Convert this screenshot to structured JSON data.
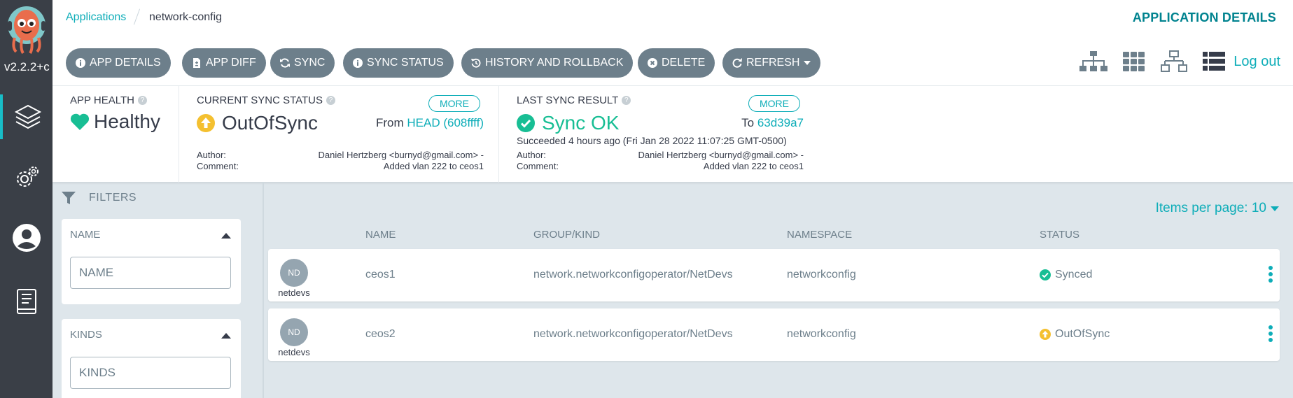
{
  "sidebar": {
    "version": "v2.2.2+c",
    "items": [
      {
        "name": "applications"
      },
      {
        "name": "settings"
      },
      {
        "name": "user-info"
      },
      {
        "name": "documentation"
      }
    ]
  },
  "breadcrumb": {
    "root": "Applications",
    "current": "network-config"
  },
  "page_title": "APPLICATION DETAILS",
  "toolbar": {
    "buttons": [
      {
        "label": "APP DETAILS",
        "icon": "info-circle-icon"
      },
      {
        "label": "APP DIFF",
        "icon": "file-diff-icon"
      },
      {
        "label": "SYNC",
        "icon": "sync-icon"
      },
      {
        "label": "SYNC STATUS",
        "icon": "info-circle-icon"
      },
      {
        "label": "HISTORY AND ROLLBACK",
        "icon": "history-icon"
      },
      {
        "label": "DELETE",
        "icon": "times-circle-icon"
      },
      {
        "label": "REFRESH",
        "icon": "redo-icon"
      }
    ],
    "logout": "Log out"
  },
  "app_health": {
    "label": "APP HEALTH",
    "value": "Healthy",
    "color": "#18be94"
  },
  "current_sync": {
    "label": "CURRENT SYNC STATUS",
    "more": "MORE",
    "value": "OutOfSync",
    "color": "#f4c030",
    "from_label": "From",
    "from_value": "HEAD (608ffff)",
    "author_label": "Author:",
    "comment_label": "Comment:",
    "author_value": "Daniel Hertzberg <burnyd@gmail.com> -",
    "comment_value": "Added vlan 222 to ceos1"
  },
  "last_sync": {
    "label": "LAST SYNC RESULT",
    "more": "MORE",
    "value": "Sync OK",
    "color": "#18be94",
    "to_label": "To",
    "to_value": "63d39a7",
    "succeeded": "Succeeded 4 hours ago (Fri Jan 28 2022 11:07:25 GMT-0500)",
    "author_label": "Author:",
    "comment_label": "Comment:",
    "author_value": "Daniel Hertzberg <burnyd@gmail.com> -",
    "comment_value": "Added vlan 222 to ceos1"
  },
  "filters": {
    "title": "FILTERS",
    "name_title": "NAME",
    "name_placeholder": "NAME",
    "kinds_title": "KINDS",
    "kinds_placeholder": "KINDS"
  },
  "table": {
    "items_per_page": "Items per page: 10",
    "headers": {
      "name": "NAME",
      "group_kind": "GROUP/KIND",
      "namespace": "NAMESPACE",
      "status": "STATUS"
    },
    "rows": [
      {
        "avatar": "ND",
        "kind_label": "netdevs",
        "name": "ceos1",
        "group_kind": "network.networkconfigoperator/NetDevs",
        "namespace": "networkconfig",
        "status": "Synced",
        "status_color": "#18be94"
      },
      {
        "avatar": "ND",
        "kind_label": "netdevs",
        "name": "ceos2",
        "group_kind": "network.networkconfigoperator/NetDevs",
        "namespace": "networkconfig",
        "status": "OutOfSync",
        "status_color": "#f4c030"
      }
    ]
  }
}
